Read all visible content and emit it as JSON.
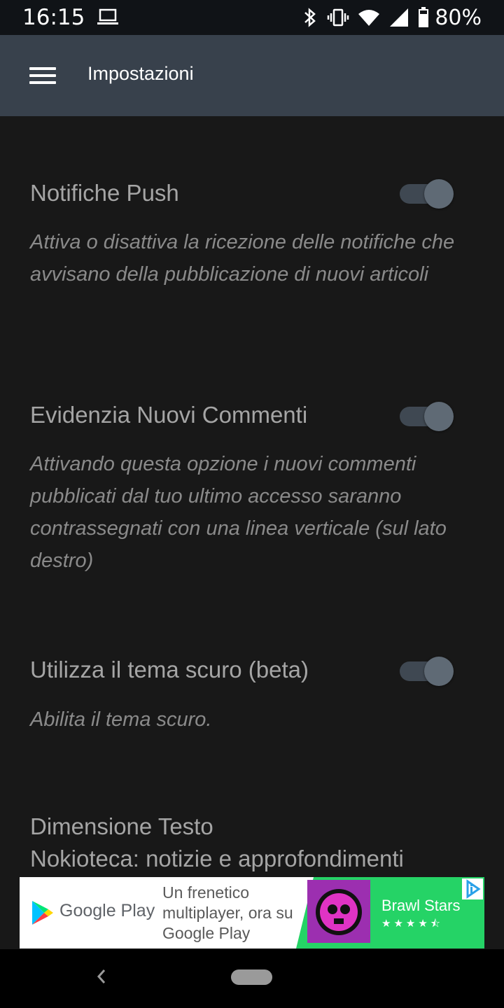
{
  "status_bar": {
    "time": "16:15",
    "battery_percent": "80%",
    "icons": [
      "laptop-icon",
      "bluetooth-icon",
      "vibrate-icon",
      "wifi-icon",
      "signal-icon",
      "battery-icon"
    ]
  },
  "app_bar": {
    "title": "Impostazioni",
    "menu_icon": "hamburger-menu-icon",
    "background_color": "#38414c"
  },
  "settings": [
    {
      "title": "Notifiche Push",
      "description": "Attiva o disattiva la ricezione delle notifiche che avvisano della pubblicazione di nuovi articoli",
      "enabled": true
    },
    {
      "title": "Evidenzia Nuovi Commenti",
      "description": "Attivando questa opzione i nuovi commenti pubblicati dal tuo ultimo accesso saranno contrassegnati con una linea verticale (sul lato destro)",
      "enabled": true
    },
    {
      "title": "Utilizza il tema scuro (beta)",
      "description": "Abilita il tema scuro.",
      "enabled": true
    },
    {
      "title": "Dimensione Testo",
      "subtitle": "Nokioteca: notizie e approfondimenti"
    }
  ],
  "ad": {
    "store_name": "Google Play",
    "text": "Un frenetico multiplayer, ora su Google Play",
    "app_name": "Brawl Stars",
    "rating_stars": "★★★★⯪",
    "rating": 4.5,
    "accent_color": "#25d366"
  },
  "nav_bar": {
    "back_icon": "back-chevron-icon",
    "home_icon": "home-pill-icon"
  }
}
